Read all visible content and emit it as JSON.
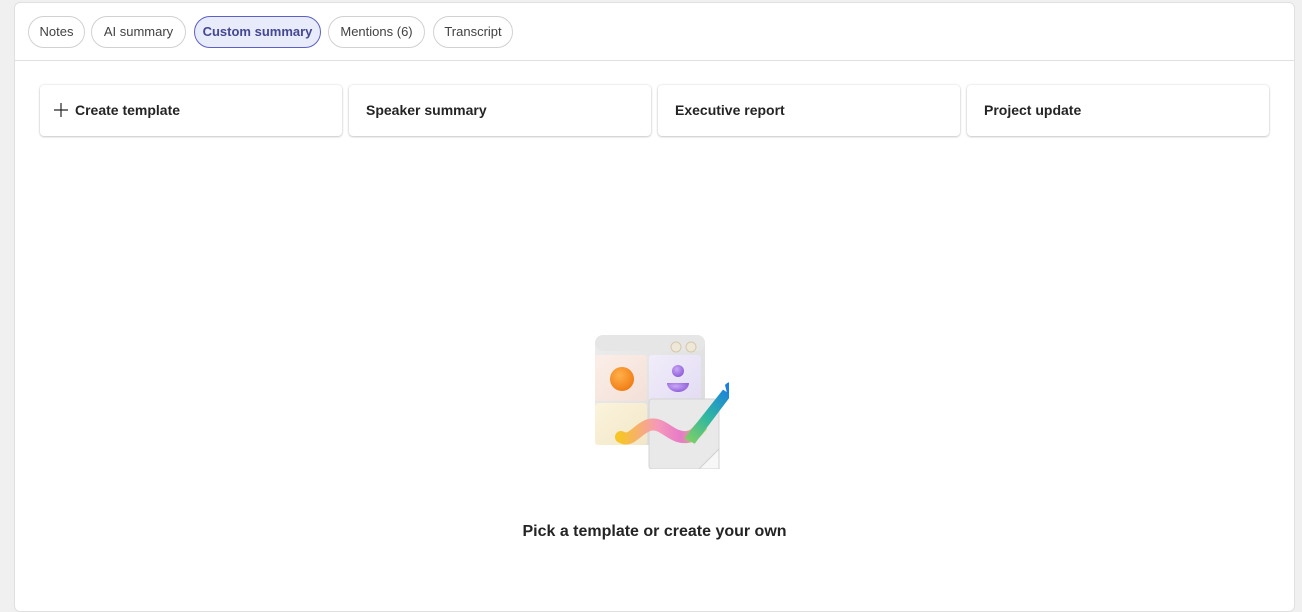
{
  "tabs": [
    {
      "label": "Notes",
      "active": false
    },
    {
      "label": "AI summary",
      "active": false
    },
    {
      "label": "Custom summary",
      "active": true
    },
    {
      "label": "Mentions (6)",
      "active": false
    },
    {
      "label": "Transcript",
      "active": false
    }
  ],
  "templates": {
    "create_label": "Create template",
    "items": [
      {
        "label": "Speaker summary"
      },
      {
        "label": "Executive report"
      },
      {
        "label": "Project update"
      }
    ]
  },
  "empty_state": {
    "illustration": "template-canvas-with-pen-illustration",
    "message": "Pick a template or create your own"
  },
  "colors": {
    "accent": "#5b5fc7",
    "active_tab_bg": "#e8ebfa",
    "active_tab_text": "#444791"
  }
}
